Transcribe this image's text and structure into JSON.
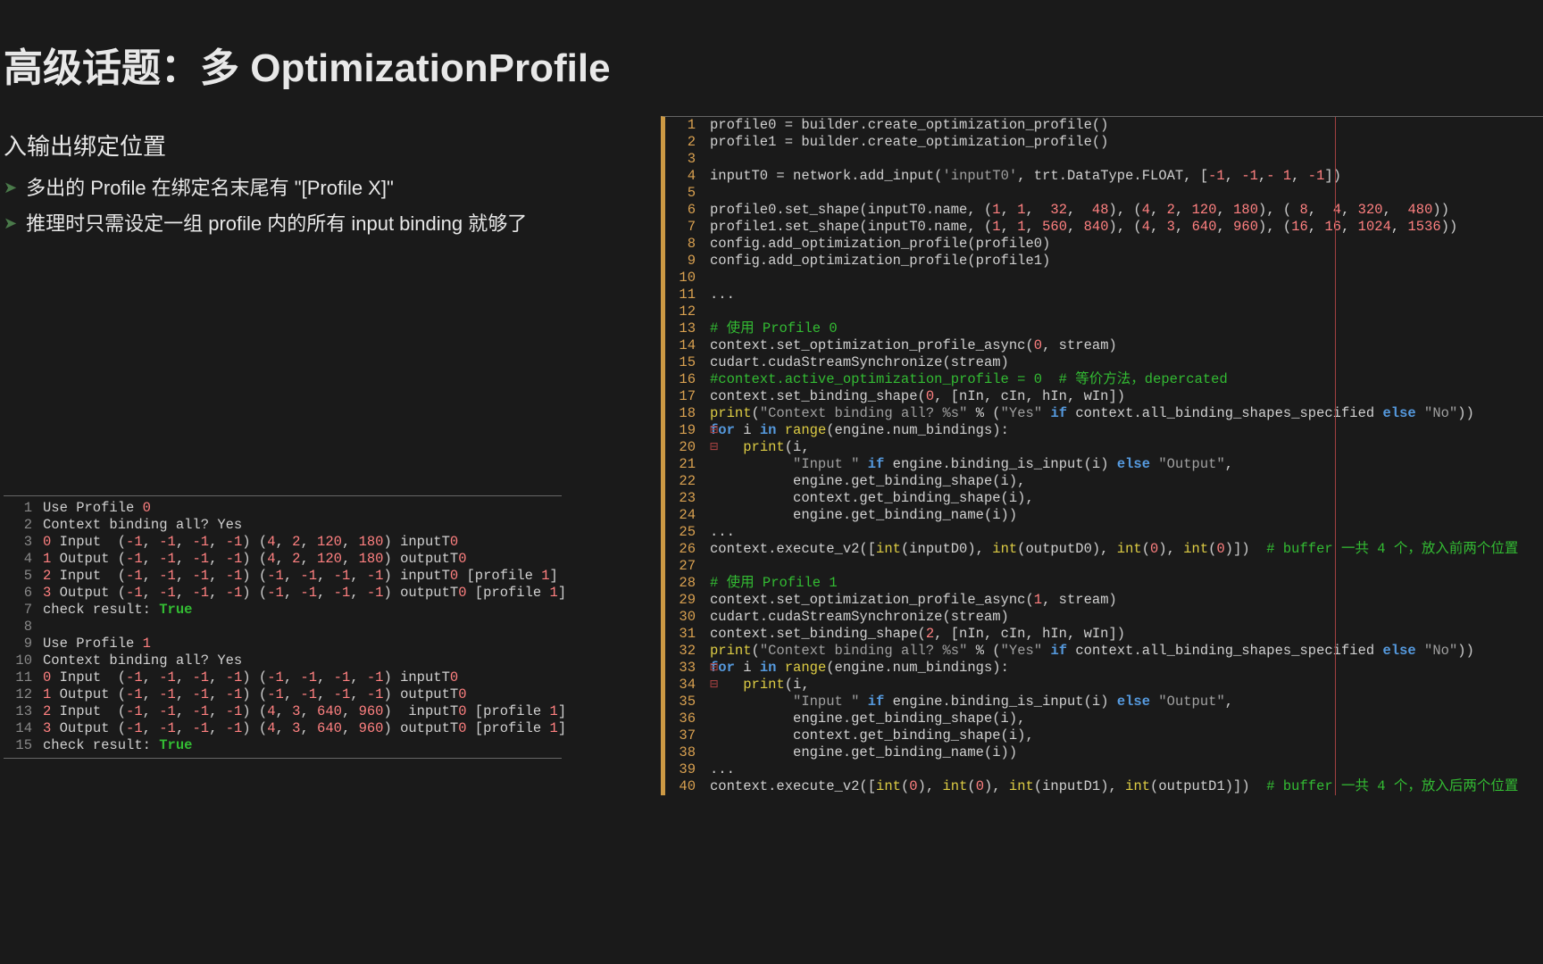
{
  "title": "高级话题：多 OptimizationProfile",
  "subtitle": "入输出绑定位置",
  "bullets": [
    "多出的 Profile 在绑定名末尾有 \"[Profile X]\"",
    "推理时只需设定一组 profile 内的所有 input binding 就够了"
  ],
  "small_code": [
    {
      "n": "1",
      "t": "Use Profile 0"
    },
    {
      "n": "2",
      "t": "Context binding all? Yes"
    },
    {
      "n": "3",
      "t": "0 Input  (-1, -1, -1, -1) (4, 2, 120, 180) inputT0"
    },
    {
      "n": "4",
      "t": "1 Output (-1, -1, -1, -1) (4, 2, 120, 180) outputT0"
    },
    {
      "n": "5",
      "t": "2 Input  (-1, -1, -1, -1) (-1, -1, -1, -1) inputT0 [profile 1]"
    },
    {
      "n": "6",
      "t": "3 Output (-1, -1, -1, -1) (-1, -1, -1, -1) outputT0 [profile 1]"
    },
    {
      "n": "7",
      "t": "check result: True"
    },
    {
      "n": "8",
      "t": ""
    },
    {
      "n": "9",
      "t": "Use Profile 1"
    },
    {
      "n": "10",
      "t": "Context binding all? Yes"
    },
    {
      "n": "11",
      "t": "0 Input  (-1, -1, -1, -1) (-1, -1, -1, -1) inputT0"
    },
    {
      "n": "12",
      "t": "1 Output (-1, -1, -1, -1) (-1, -1, -1, -1) outputT0"
    },
    {
      "n": "13",
      "t": "2 Input  (-1, -1, -1, -1) (4, 3, 640, 960)  inputT0 [profile 1]"
    },
    {
      "n": "14",
      "t": "3 Output (-1, -1, -1, -1) (4, 3, 640, 960) outputT0 [profile 1]"
    },
    {
      "n": "15",
      "t": "check result: True"
    }
  ],
  "big_code_lines": 40
}
